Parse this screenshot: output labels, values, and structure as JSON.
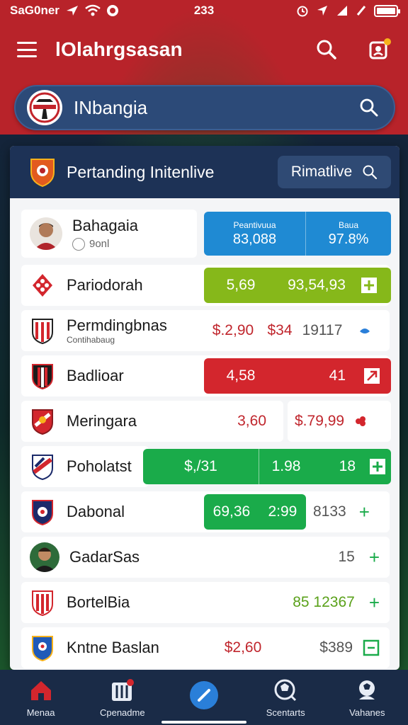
{
  "status_bar": {
    "carrier": "SaG0ner",
    "time": "233"
  },
  "app_bar": {
    "title": "lOlahrgsasan"
  },
  "search": {
    "text": "INbangia"
  },
  "card": {
    "title": "Pertanding Initenlive",
    "live_label": "Rimatlive"
  },
  "rows": [
    {
      "name": "Bahagaia",
      "sub": "9onl",
      "left_w": 248,
      "right_l": 258,
      "right_w": 264,
      "style": "blue",
      "col1_head": "Peantivuua",
      "col1_val": "83,088",
      "col2_head": "Baua",
      "col2_val": "97.8%"
    },
    {
      "name": "Pariodorah",
      "v1": "5,69",
      "v2": "93,54,93",
      "style": "lime"
    },
    {
      "name": "Permdingbnas",
      "sub": "Contihabaug",
      "v1": "$.2,90",
      "v2": "$34",
      "v3": "19117",
      "style": "white-red"
    },
    {
      "name": "Badlioar",
      "v1": "4,58",
      "v2": "41",
      "style": "red"
    },
    {
      "name": "Meringara",
      "v1": "3,60",
      "v2": "$.79,99",
      "style": "white-split"
    },
    {
      "name": "Poholatst",
      "v1": "$,/31",
      "v2": "1.98",
      "v3": "18",
      "style": "green-wide"
    },
    {
      "name": "Dabonal",
      "v1": "69,36",
      "v2": "2:99",
      "v3": "8133",
      "style": "green-mid"
    },
    {
      "name": "GadarSas",
      "v1": "15",
      "style": "plain"
    },
    {
      "name": "BortelBia",
      "v1": "85 12367",
      "style": "plain-green"
    },
    {
      "name": "Kntne Baslan",
      "v1": "$2,60",
      "v2": "$389",
      "style": "plain-red"
    }
  ],
  "bottom_nav": [
    {
      "label": "Menaa"
    },
    {
      "label": "Cpenadme"
    },
    {
      "label": ""
    },
    {
      "label": "Scentarts"
    },
    {
      "label": "Vahanes"
    }
  ],
  "colors": {
    "brand_red": "#b8232a",
    "navy": "#1d3256",
    "blue": "#1f8ad3",
    "lime": "#86b81a",
    "red": "#d3262d",
    "green": "#1aab4a"
  }
}
